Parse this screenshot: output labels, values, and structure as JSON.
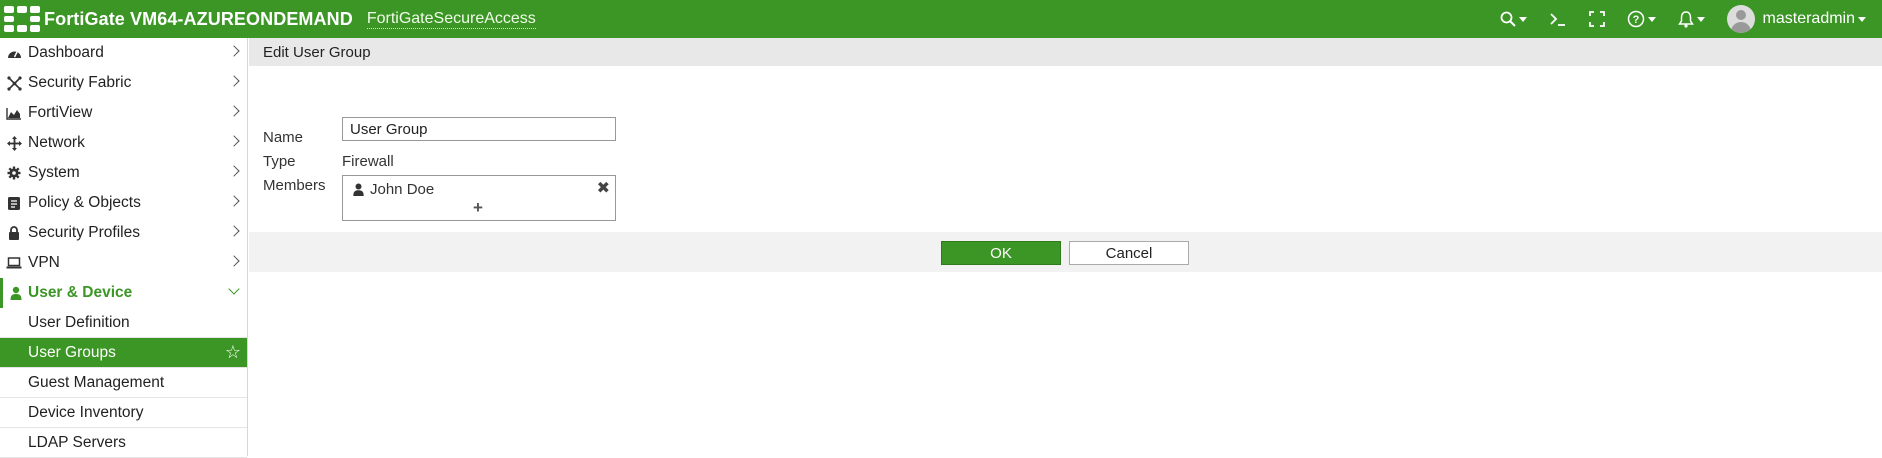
{
  "header": {
    "hostname": "FortiGate VM64-AZUREONDEMAND",
    "vdom": "FortiGateSecureAccess",
    "username": "masteradmin",
    "icons": [
      "search-icon",
      "cli-console-icon",
      "fullscreen-icon",
      "help-icon",
      "notifications-icon"
    ]
  },
  "sidebar": {
    "items": [
      {
        "label": "Dashboard",
        "icon": "dashboard-icon"
      },
      {
        "label": "Security Fabric",
        "icon": "security-fabric-icon"
      },
      {
        "label": "FortiView",
        "icon": "chart-icon"
      },
      {
        "label": "Network",
        "icon": "network-icon"
      },
      {
        "label": "System",
        "icon": "gear-icon"
      },
      {
        "label": "Policy & Objects",
        "icon": "policy-icon"
      },
      {
        "label": "Security Profiles",
        "icon": "lock-icon"
      },
      {
        "label": "VPN",
        "icon": "laptop-icon"
      },
      {
        "label": "User & Device",
        "icon": "user-icon"
      }
    ],
    "sub_items": [
      {
        "label": "User Definition"
      },
      {
        "label": "User Groups"
      },
      {
        "label": "Guest Management"
      },
      {
        "label": "Device Inventory"
      },
      {
        "label": "LDAP Servers"
      }
    ]
  },
  "page": {
    "title": "Edit User Group",
    "name_label": "Name",
    "name_value": "User Group",
    "type_label": "Type",
    "type_value": "Firewall",
    "members_label": "Members",
    "members": [
      {
        "name": "John Doe"
      }
    ],
    "add_symbol": "+",
    "ok_label": "OK",
    "cancel_label": "Cancel"
  },
  "colors": {
    "accent": "#3c9625",
    "header_bg": "#e8e8e8",
    "footer_bg": "#f2f2f2"
  }
}
